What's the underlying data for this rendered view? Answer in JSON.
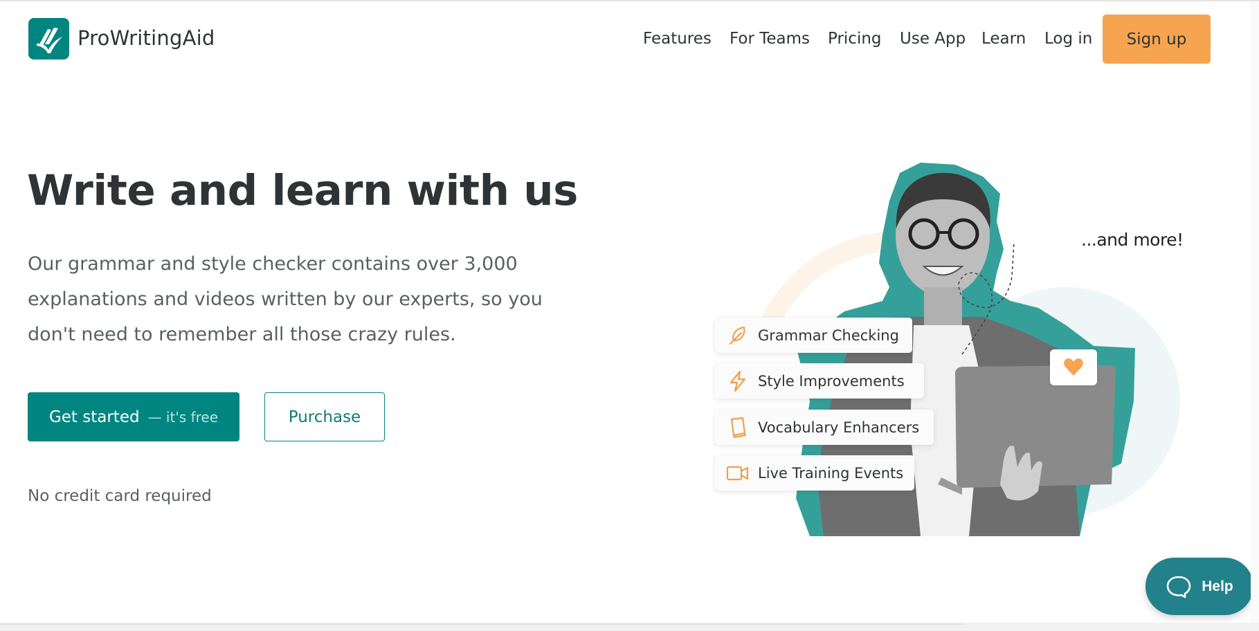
{
  "header": {
    "brand": "ProWritingAid",
    "nav": [
      "Features",
      "For Teams",
      "Pricing",
      "Use App",
      "Learn",
      "Log in"
    ],
    "signup_label": "Sign up"
  },
  "hero": {
    "headline": "Write and learn with us",
    "paragraph": "Our grammar and style checker contains over 3,000 explanations and videos written by our experts, so you don't need to remember all those crazy rules.",
    "primary_button": "Get started",
    "primary_button_sub": "— it's free",
    "secondary_button": "Purchase",
    "note": "No credit card required"
  },
  "illustration": {
    "features": [
      {
        "label": "Grammar Checking",
        "icon": "feather-icon"
      },
      {
        "label": "Style Improvements",
        "icon": "lightning-icon"
      },
      {
        "label": "Vocabulary Enhancers",
        "icon": "book-icon"
      },
      {
        "label": "Live Training Events",
        "icon": "video-camera-icon"
      }
    ],
    "annotation": "...and more!",
    "badge_icon": "heart-icon"
  },
  "help_widget": {
    "label": "Help",
    "icon": "chat-bubble-icon"
  },
  "colors": {
    "brand_teal": "#008580",
    "accent_orange": "#f7a451",
    "help_teal": "#22818a",
    "text_dark": "#2f3336"
  }
}
